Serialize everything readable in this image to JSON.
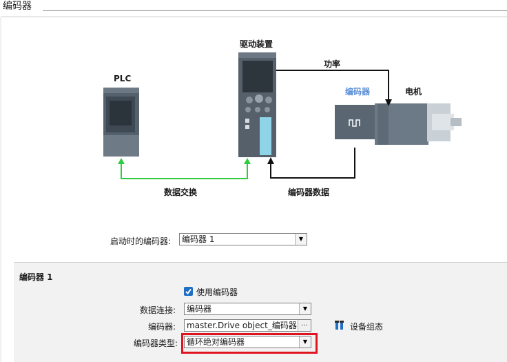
{
  "tab": {
    "title": "编码器"
  },
  "diagram": {
    "plc_label": "PLC",
    "drive_label": "驱动装置",
    "power_label": "功率",
    "encoder_label": "编码器",
    "motor_label": "电机",
    "data_exchange_label": "数据交换",
    "encoder_data_label": "编码器数据",
    "colors": {
      "green_link": "#2ecc40",
      "encoder_label": "#5b8fd6",
      "red_highlight": "#e0141e"
    }
  },
  "startup": {
    "label": "启动时的编码器:",
    "value": "编码器 1"
  },
  "encoder_section": {
    "title": "编码器 1",
    "use_encoder_label": "使用编码器",
    "use_encoder_checked": true,
    "data_connection_label": "数据连接:",
    "data_connection_value": "编码器",
    "encoder_label": "编码器:",
    "encoder_value": "master.Drive object_编码器1",
    "browse_label": "...",
    "device_config_label": "设备组态",
    "encoder_type_label": "编码器类型:",
    "encoder_type_value": "循环绝对编码器"
  }
}
